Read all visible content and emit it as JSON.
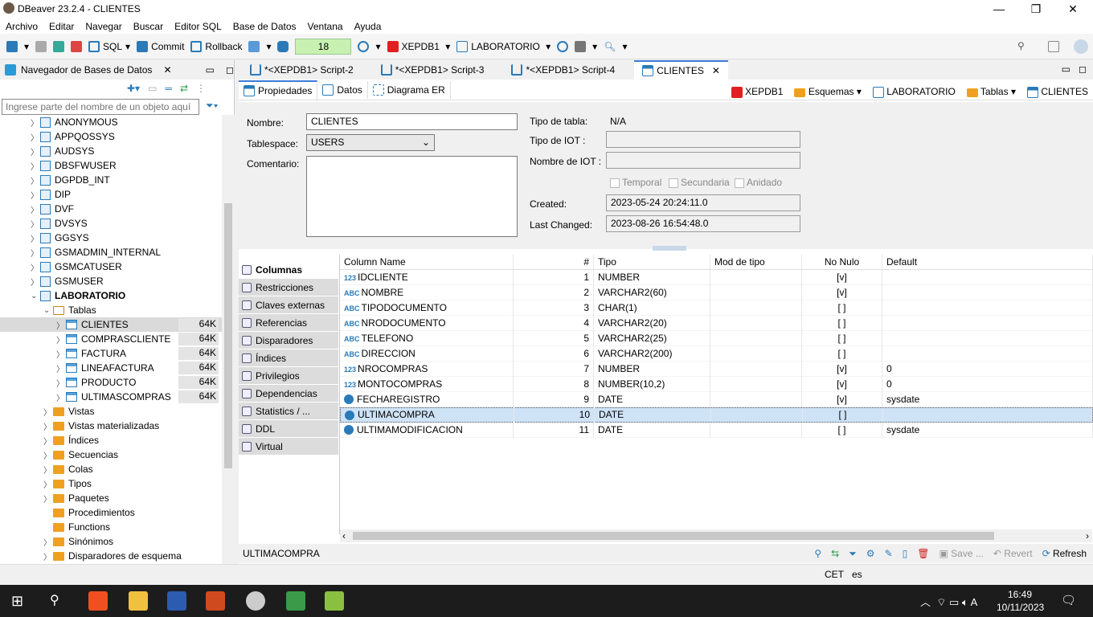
{
  "window": {
    "title": "DBeaver 23.2.4 - CLIENTES",
    "minimize": "—",
    "maximize": "❐",
    "close": "✕"
  },
  "menu": [
    "Archivo",
    "Editar",
    "Navegar",
    "Buscar",
    "Editor SQL",
    "Base de Datos",
    "Ventana",
    "Ayuda"
  ],
  "toolbar": {
    "sql": "SQL",
    "commit": "Commit",
    "rollback": "Rollback",
    "txn_count": "18",
    "connection": "XEPDB1",
    "schema": "LABORATORIO"
  },
  "navigator": {
    "title": "Navegador de Bases de Datos",
    "filter_placeholder": "Ingrese parte del nombre de un objeto aquí",
    "schemas_before": [
      "ANONYMOUS",
      "APPQOSSYS",
      "AUDSYS",
      "DBSFWUSER",
      "DGPDB_INT",
      "DIP",
      "DVF",
      "DVSYS",
      "GGSYS",
      "GSMADMIN_INTERNAL",
      "GSMCATUSER",
      "GSMUSER"
    ],
    "current_schema": "LABORATORIO",
    "tables_folder": "Tablas",
    "tables": [
      {
        "name": "CLIENTES",
        "size": "64K"
      },
      {
        "name": "COMPRASCLIENTE",
        "size": "64K"
      },
      {
        "name": "FACTURA",
        "size": "64K"
      },
      {
        "name": "LINEAFACTURA",
        "size": "64K"
      },
      {
        "name": "PRODUCTO",
        "size": "64K"
      },
      {
        "name": "ULTIMASCOMPRAS",
        "size": "64K"
      }
    ],
    "folders": [
      "Vistas",
      "Vistas materializadas",
      "Índices",
      "Secuencias",
      "Colas",
      "Tipos",
      "Paquetes",
      "Procedimientos",
      "Functions",
      "Sinónimos",
      "Disparadores de esquema"
    ]
  },
  "editor_tabs": [
    "*<XEPDB1> Script-2",
    "*<XEPDB1> Script-3",
    "*<XEPDB1> Script-4",
    "CLIENTES"
  ],
  "sub_tabs": [
    "Propiedades",
    "Datos",
    "Diagrama ER"
  ],
  "breadcrumb": [
    "XEPDB1",
    "Esquemas",
    "LABORATORIO",
    "Tablas",
    "CLIENTES"
  ],
  "props": {
    "nombre_label": "Nombre:",
    "nombre": "CLIENTES",
    "tablespace_label": "Tablespace:",
    "tablespace": "USERS",
    "comentario_label": "Comentario:",
    "tipo_tabla_label": "Tipo de tabla:",
    "tipo_tabla": "N/A",
    "tipo_iot_label": "Tipo de IOT :",
    "nombre_iot_label": "Nombre de IOT :",
    "temporal": "Temporal",
    "secundaria": "Secundaria",
    "anidado": "Anidado",
    "created_label": "Created:",
    "created": "2023-05-24 20:24:11.0",
    "changed_label": "Last Changed:",
    "changed": "2023-08-26 16:54:48.0"
  },
  "side_sections": [
    "Columnas",
    "Restricciones",
    "Claves externas",
    "Referencias",
    "Disparadores",
    "Índices",
    "Privilegios",
    "Dependencias",
    "Statistics / ...",
    "DDL",
    "Virtual"
  ],
  "columns_header": [
    "Column Name",
    "#",
    "Tipo",
    "Mod de tipo",
    "No Nulo",
    "Default"
  ],
  "columns": [
    {
      "kind": "123",
      "name": "IDCLIENTE",
      "n": "1",
      "type": "NUMBER",
      "notnull": "[v]",
      "def": ""
    },
    {
      "kind": "ABC",
      "name": "NOMBRE",
      "n": "2",
      "type": "VARCHAR2(60)",
      "notnull": "[v]",
      "def": ""
    },
    {
      "kind": "ABC",
      "name": "TIPODOCUMENTO",
      "n": "3",
      "type": "CHAR(1)",
      "notnull": "[ ]",
      "def": ""
    },
    {
      "kind": "ABC",
      "name": "NRODOCUMENTO",
      "n": "4",
      "type": "VARCHAR2(20)",
      "notnull": "[ ]",
      "def": ""
    },
    {
      "kind": "ABC",
      "name": "TELEFONO",
      "n": "5",
      "type": "VARCHAR2(25)",
      "notnull": "[ ]",
      "def": ""
    },
    {
      "kind": "ABC",
      "name": "DIRECCION",
      "n": "6",
      "type": "VARCHAR2(200)",
      "notnull": "[ ]",
      "def": ""
    },
    {
      "kind": "123",
      "name": "NROCOMPRAS",
      "n": "7",
      "type": "NUMBER",
      "notnull": "[v]",
      "def": "0"
    },
    {
      "kind": "123",
      "name": "MONTOCOMPRAS",
      "n": "8",
      "type": "NUMBER(10,2)",
      "notnull": "[v]",
      "def": "0"
    },
    {
      "kind": "date",
      "name": "FECHAREGISTRO",
      "n": "9",
      "type": "DATE",
      "notnull": "[v]",
      "def": "sysdate"
    },
    {
      "kind": "date",
      "name": "ULTIMACOMPRA",
      "n": "10",
      "type": "DATE",
      "notnull": "[ ]",
      "def": ""
    },
    {
      "kind": "date",
      "name": "ULTIMAMODIFICACION",
      "n": "11",
      "type": "DATE",
      "notnull": "[ ]",
      "def": "sysdate"
    }
  ],
  "status": {
    "selected": "ULTIMACOMPRA",
    "save": "Save ...",
    "revert": "Revert",
    "refresh": "Refresh",
    "tz": "CET",
    "locale": "es"
  },
  "taskbar": {
    "time": "16:49",
    "date": "10/11/2023"
  }
}
